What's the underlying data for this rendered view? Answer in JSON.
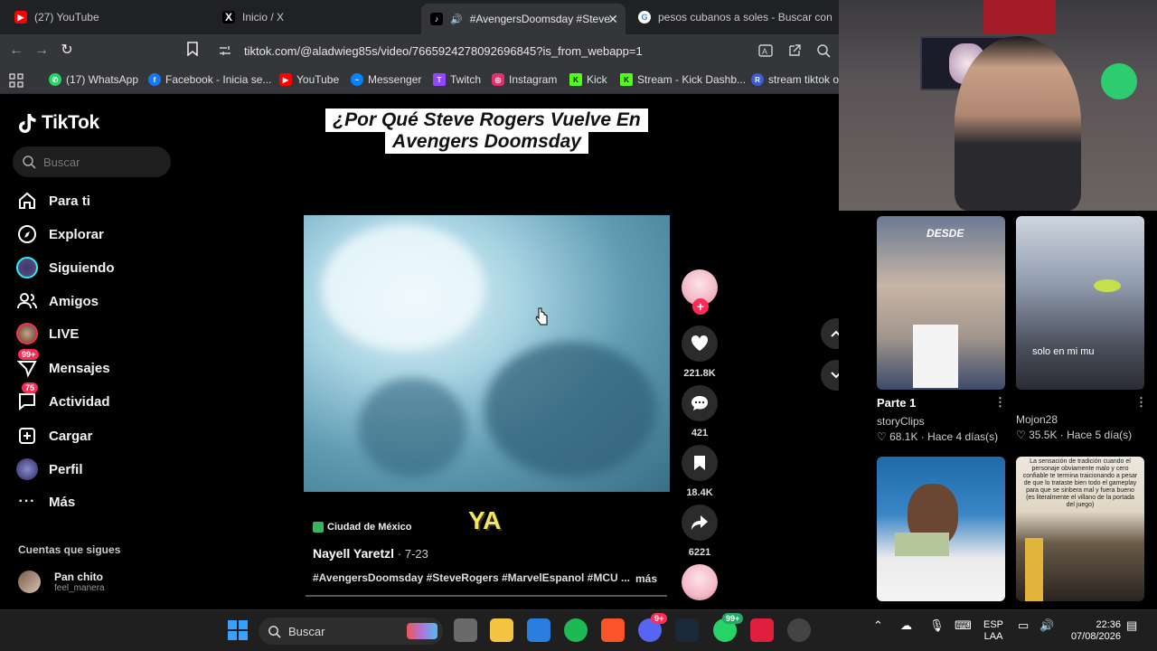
{
  "browser": {
    "tabs": [
      {
        "title": "(27) YouTube",
        "icon": "youtube-icon",
        "color": "#ff0000"
      },
      {
        "title": "Inicio / X",
        "icon": "x-icon",
        "color": "#000000"
      },
      {
        "title": "#AvengersDoomsday #Steve",
        "icon": "tiktok-icon",
        "color": "#000000"
      },
      {
        "title": "pesos cubanos a soles - Buscar con G",
        "icon": "google-icon",
        "color": "#4285f4"
      }
    ],
    "url": "tiktok.com/@aladwieg85s/video/7665924278092696845?is_from_webapp=1",
    "bookmarks": [
      {
        "label": "(17) WhatsApp",
        "color": "#25d366"
      },
      {
        "label": "Facebook - Inicia se...",
        "color": "#1877f2"
      },
      {
        "label": "YouTube",
        "color": "#ff0000"
      },
      {
        "label": "Messenger",
        "color": "#0084ff"
      },
      {
        "label": "Twitch",
        "color": "#9146ff"
      },
      {
        "label": "Instagram",
        "color": "#e1306c"
      },
      {
        "label": "Kick",
        "color": "#53fc18"
      },
      {
        "label": "Stream - Kick Dashb...",
        "color": "#53fc18"
      },
      {
        "label": "stream tiktok ol",
        "color": "#3b5bdb"
      }
    ]
  },
  "tiktok": {
    "logo": "TikTok",
    "search_placeholder": "Buscar",
    "nav": [
      {
        "label": "Para ti",
        "icon": "home-icon"
      },
      {
        "label": "Explorar",
        "icon": "compass-icon"
      },
      {
        "label": "Siguiendo",
        "icon": "following-icon"
      },
      {
        "label": "Amigos",
        "icon": "friends-icon"
      },
      {
        "label": "LIVE",
        "icon": "live-icon"
      },
      {
        "label": "Mensajes",
        "icon": "messages-icon",
        "badge": "99+"
      },
      {
        "label": "Actividad",
        "icon": "activity-icon",
        "badge": "75"
      },
      {
        "label": "Cargar",
        "icon": "upload-icon"
      },
      {
        "label": "Perfil",
        "icon": "profile-icon"
      },
      {
        "label": "Más",
        "icon": "more-icon"
      }
    ],
    "following_title": "Cuentas que sigues",
    "following": [
      {
        "name": "Pan chito",
        "handle": "feel_manera"
      }
    ],
    "video": {
      "title_line1": "¿Por Qué Steve Rogers Vuelve En",
      "title_line2": "Avengers Doomsday",
      "overlay_caption": "YA",
      "location": "Ciudad de México",
      "author": "Nayell Yaretzl",
      "date": "· 7-23",
      "hashtags": "#AvengersDoomsday #SteveRogers #MarvelEspanol #MCU ...",
      "more": "más"
    },
    "actions": {
      "likes": "221.8K",
      "comments": "421",
      "saves": "18.4K",
      "shares": "6221"
    }
  },
  "side_videos": [
    {
      "overlay": "DESDE",
      "title": "Parte 1",
      "author": "storyClips",
      "stats": "68.1K · Hace 4 días(s)"
    },
    {
      "overlay": "solo en mi mu",
      "title": "",
      "author": "Mojon28",
      "stats": "35.5K · Hace 5 día(s)"
    },
    {
      "overlay": "",
      "title": "",
      "author": "",
      "stats": ""
    },
    {
      "overlay": "La sensación de tradición cuando el personaje obviamente malo y cero confiable te termina traicionando a pesar de que lo trataste bien todo el gameplay para que se sinbera mal y fuera bueno (es literalmente el villano de la portada del juego)",
      "title": "",
      "author": "",
      "stats": ""
    }
  ],
  "taskbar": {
    "search": "Buscar",
    "lang": "ESP",
    "lang2": "LAA",
    "time": "22:36",
    "date": "07/08/2026",
    "discord_badge": "9+",
    "whatsapp_badge": "99+"
  }
}
